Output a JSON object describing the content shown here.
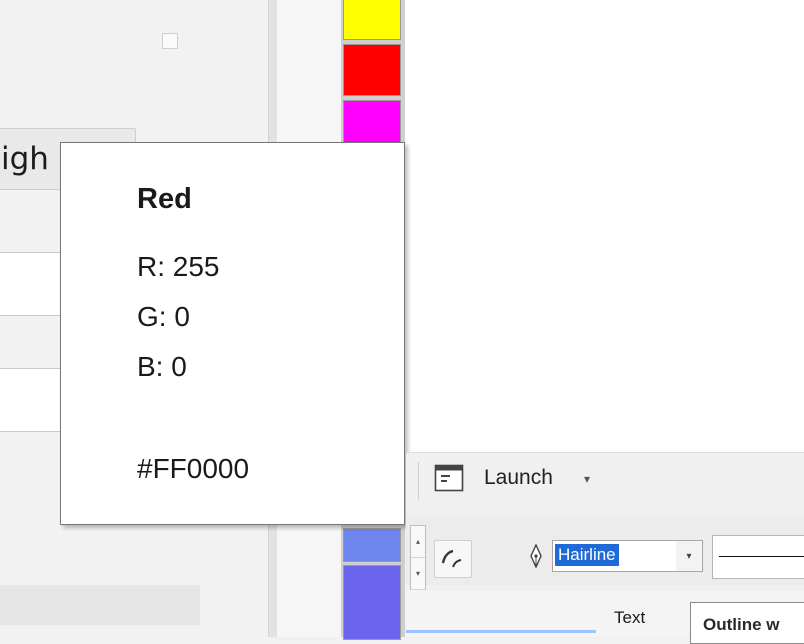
{
  "docker": {
    "weight_button_label": "igh"
  },
  "palette": {
    "swatches": [
      {
        "name": "Yellow",
        "color": "#ffff00"
      },
      {
        "name": "Red",
        "color": "#ff0000"
      },
      {
        "name": "Magenta",
        "color": "#ff00ff"
      },
      {
        "name": "Cornflower",
        "color": "#6f86f0"
      },
      {
        "name": "Blue Violet",
        "color": "#6a64ee"
      }
    ]
  },
  "tooltip": {
    "color_name": "Red",
    "r_line": "R: 255",
    "g_line": "G: 0",
    "b_line": "B: 0",
    "hex": "#FF0000"
  },
  "toolbar": {
    "launch_label": "Launch",
    "launch_icon": "window-icon",
    "launch_caret": "▾",
    "outline_width_value": "Hairline",
    "outline_drop": "▾",
    "spinner_up": "▴",
    "spinner_down": "▾",
    "text_label": "Text",
    "tip_text": "Outline w"
  }
}
